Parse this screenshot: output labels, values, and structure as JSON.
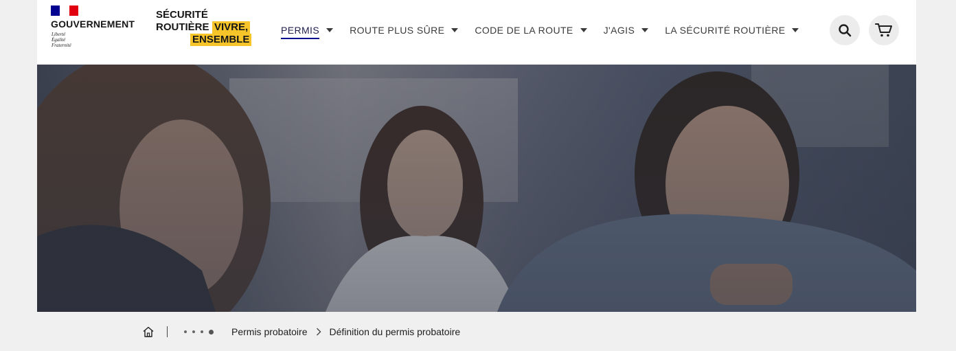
{
  "header": {
    "gov": {
      "title": "GOUVERNEMENT",
      "motto": [
        "Liberté",
        "Égalité",
        "Fraternité"
      ]
    },
    "brand": {
      "line1": "SÉCURITÉ",
      "line2": "ROUTIÈRE",
      "tag1": "VIVRE,",
      "tag2": "ENSEMBLE"
    },
    "nav": [
      {
        "label": "PERMIS"
      },
      {
        "label": "ROUTE PLUS SÛRE"
      },
      {
        "label": "CODE DE LA ROUTE"
      },
      {
        "label": "J'AGIS"
      },
      {
        "label": "LA SÉCURITÉ ROUTIÈRE"
      }
    ],
    "icons": {
      "search": "search-icon",
      "cart": "cart-icon"
    }
  },
  "hero": {
    "image": "photo of smiling young people in a car"
  },
  "breadcrumb": {
    "items": [
      "Permis probatoire",
      "Définition du permis probatoire"
    ]
  },
  "colors": {
    "accent": "#000091",
    "brand_yellow": "#f7c429",
    "flag_red": "#e1000f"
  }
}
